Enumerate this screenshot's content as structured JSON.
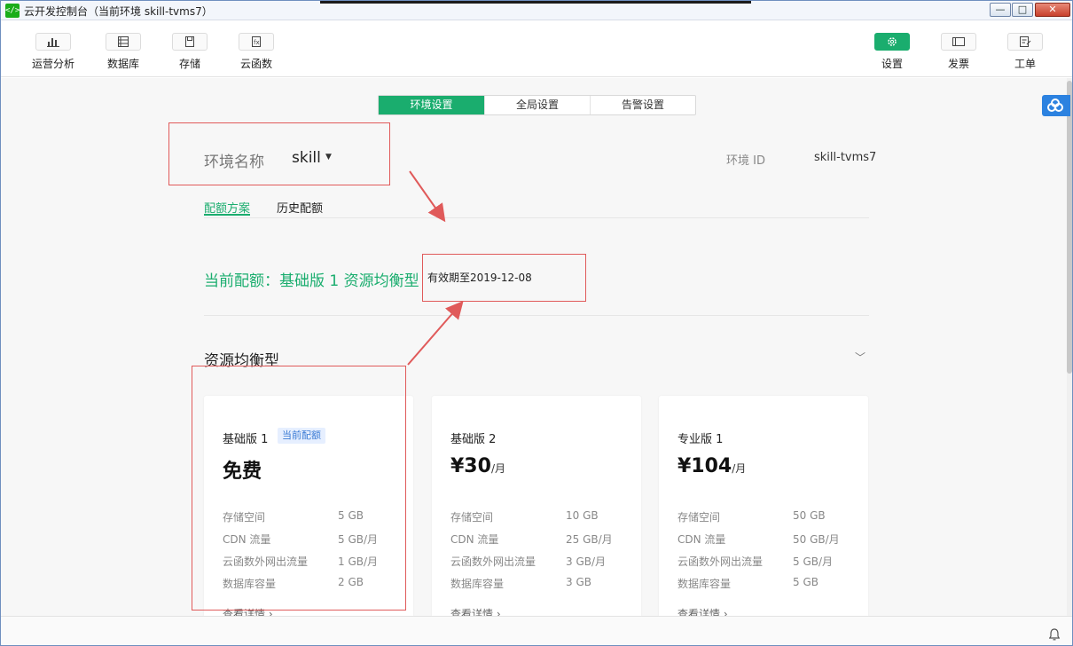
{
  "window": {
    "title": "云开发控制台（当前环境 skill-tvms7）",
    "min_glyph": "—",
    "max_glyph": "□",
    "close_glyph": "✕"
  },
  "toolbar": {
    "left": [
      {
        "label": "运营分析",
        "icon": "bar-chart-icon"
      },
      {
        "label": "数据库",
        "icon": "database-icon"
      },
      {
        "label": "存储",
        "icon": "storage-icon"
      },
      {
        "label": "云函数",
        "icon": "function-icon"
      }
    ],
    "right": [
      {
        "label": "设置",
        "icon": "gear-icon",
        "active": true
      },
      {
        "label": "发票",
        "icon": "invoice-icon"
      },
      {
        "label": "工单",
        "icon": "ticket-icon"
      }
    ]
  },
  "tabs": [
    "环境设置",
    "全局设置",
    "告警设置"
  ],
  "env": {
    "label": "环境名称",
    "name": "skill",
    "id_label": "环境 ID",
    "id_value": "skill-tvms7"
  },
  "subtabs": [
    "配额方案",
    "历史配额"
  ],
  "quota": {
    "current": "当前配额：基础版 1 资源均衡型",
    "expiry": "有效期至2019-12-08"
  },
  "group": {
    "title": "资源均衡型"
  },
  "spec_labels": [
    "存储空间",
    "CDN 流量",
    "云函数外网出流量",
    "数据库容量"
  ],
  "plans": [
    {
      "name": "基础版 1",
      "badge": "当前配额",
      "price": "免费",
      "unit": "",
      "values": [
        "5 GB",
        "5 GB/月",
        "1 GB/月",
        "2 GB"
      ],
      "more": "查看详情 ›"
    },
    {
      "name": "基础版 2",
      "badge": "",
      "price": "¥30",
      "unit": "/月",
      "values": [
        "10 GB",
        "25 GB/月",
        "3 GB/月",
        "3 GB"
      ],
      "more": "查看详情 ›"
    },
    {
      "name": "专业版 1",
      "badge": "",
      "price": "¥104",
      "unit": "/月",
      "values": [
        "50 GB",
        "50 GB/月",
        "5 GB/月",
        "5 GB"
      ],
      "more": "查看详情 ›"
    }
  ],
  "colors": {
    "accent": "#1aad6e",
    "annotation": "#e05a5a",
    "badge_text": "#3b7bd4",
    "badge_bg": "#e6efff"
  }
}
